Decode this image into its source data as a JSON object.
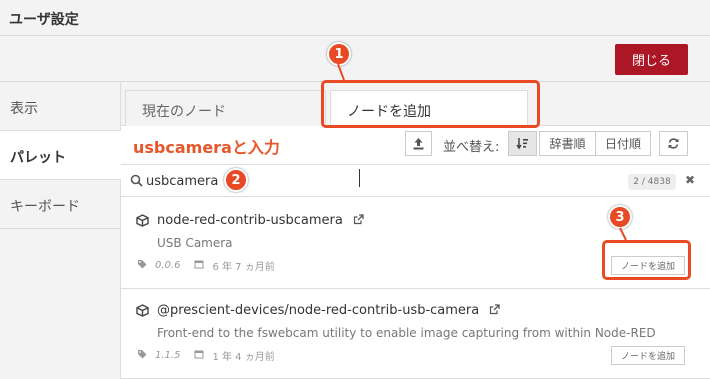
{
  "window": {
    "title": "ユーザ設定"
  },
  "toolbar": {
    "close_label": "閉じる"
  },
  "sidebar": {
    "items": [
      {
        "label": "表示"
      },
      {
        "label": "パレット"
      },
      {
        "label": "キーボード"
      }
    ]
  },
  "tabs": [
    {
      "label": "現在のノード"
    },
    {
      "label": "ノードを追加"
    }
  ],
  "sortbar": {
    "sort_label": "並べ替え:",
    "sort_alpha": "辞書順",
    "sort_date": "日付順"
  },
  "annotations": {
    "instruction": "usbcameraと入力",
    "callout1": "1",
    "callout2": "2",
    "callout3": "3",
    "accent_color": "#e84a25"
  },
  "search": {
    "value": "usbcamera",
    "count": "2 / 4838"
  },
  "nodes": [
    {
      "name": "node-red-contrib-usbcamera",
      "description": "USB Camera",
      "version": "0.0.6",
      "updated": "6 年 7 ヵ月前",
      "add_label": "ノードを追加"
    },
    {
      "name": "@prescient-devices/node-red-contrib-usb-camera",
      "description": "Front-end to the fswebcam utility to enable image capturing from within Node-RED",
      "version": "1.1.5",
      "updated": "1 年 4 ヵ月前",
      "add_label": "ノードを追加"
    }
  ],
  "colors": {
    "close_button": "#ad1625"
  }
}
